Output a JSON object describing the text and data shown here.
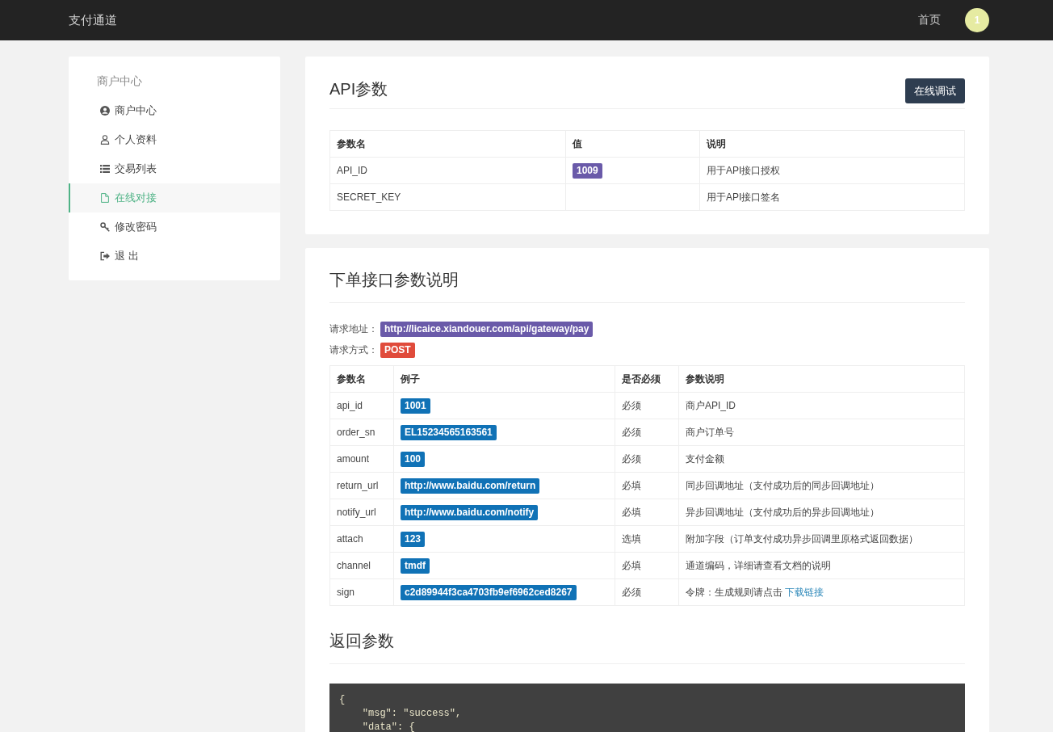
{
  "top_bar": {
    "title": "支付通道",
    "nav_links": [
      {
        "label": "首页"
      }
    ],
    "avatar": "1"
  },
  "sidebar": {
    "heading": "商户中心",
    "items": [
      {
        "label": "商户中心",
        "selected": false
      },
      {
        "label": "个人资料",
        "selected": false
      },
      {
        "label": "交易列表",
        "selected": false
      },
      {
        "label": "在线对接",
        "selected": true
      },
      {
        "label": "修改密码",
        "selected": false
      },
      {
        "label": "退 出",
        "selected": false
      }
    ]
  },
  "api_card": {
    "title": "API参数",
    "button": "在线调试",
    "table": {
      "columns": [
        "参数名",
        "值",
        "说明"
      ],
      "rows": [
        {
          "name": "API_ID",
          "value": "1009",
          "description": "用于API接口授权"
        },
        {
          "name": "SECRET_KEY",
          "description": "用于API接口签名"
        }
      ]
    }
  },
  "doc_card": {
    "title": "下单接口参数说明",
    "request": [
      {
        "label": "请求地址：",
        "value": "http://licaice.xiandouer.com/api/gateway/pay",
        "color": "#6a5aa9"
      },
      {
        "label": "请求方式：",
        "value": "POST",
        "color": "#e04b3b"
      }
    ],
    "table": {
      "columns": [
        "参数名",
        "例子",
        "是否必须",
        "参数说明"
      ],
      "rows": [
        {
          "name": "api_id",
          "example": "1001",
          "required": "必须",
          "description": "商户API_ID"
        },
        {
          "name": "order_sn",
          "example": "EL15234565163561",
          "required": "必须",
          "description": "商户订单号"
        },
        {
          "name": "amount",
          "example": "100",
          "required": "必须",
          "description": "支付金额"
        },
        {
          "name": "return_url",
          "example": "http://www.baidu.com/return",
          "required": "必填",
          "description": "同步回调地址（支付成功后的同步回调地址）"
        },
        {
          "name": "notify_url",
          "example": "http://www.baidu.com/notify",
          "required": "必填",
          "description": "异步回调地址（支付成功后的异步回调地址）"
        },
        {
          "name": "attach",
          "example": "123",
          "required": "选填",
          "description": "附加字段（订单支付成功异步回调里原格式返回数据）"
        },
        {
          "name": "channel",
          "example": "tmdf",
          "required": "必填",
          "description": "通道编码，详细请查看文档的说明"
        },
        {
          "name": "sign",
          "example": "c2d89944f3ca4703fb9ef6962ced8267",
          "required": "必须",
          "description": "令牌：生成规则请点击",
          "link": "下载链接"
        }
      ]
    },
    "return_title": "返回参数",
    "code_lines": [
      "{",
      "    \"msg\": \"success\",",
      "    \"data\": {"
    ]
  }
}
